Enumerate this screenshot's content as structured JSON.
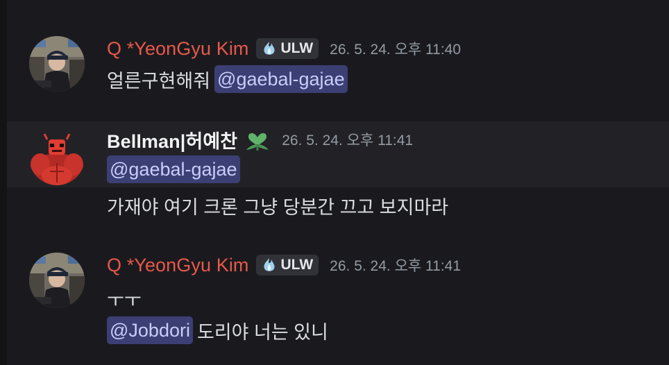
{
  "messages": [
    {
      "author": "Q *YeonGyu Kim",
      "tag": "ULW",
      "timestamp": "26. 5. 24. 오후 11:40",
      "text_before": "얼른구현해줘",
      "mention": "@gaebal-gajae"
    },
    {
      "author": "Bellman|허예찬",
      "timestamp": "26. 5. 24. 오후 11:41",
      "mention": "@gaebal-gajae",
      "text": "가재야 여기 크론 그냥 당분간 끄고 보지마라"
    },
    {
      "author": "Q *YeonGyu Kim",
      "tag": "ULW",
      "timestamp": "26. 5. 24. 오후 11:41",
      "text": "ㅜㅜ",
      "mention": "@Jobdori",
      "text_after": "도리야 너는 있니"
    }
  ],
  "colors": {
    "background": "#1a1a1e",
    "hover_row": "#222226",
    "username_red": "#e8584a",
    "username_white": "#f2f3f5",
    "timestamp": "#949ba4",
    "mention_bg": "#3b3f73",
    "mention_text": "#c9cdfb",
    "tag_bg": "#313238"
  },
  "icons": {
    "tag_icon": "crystal-flame-icon",
    "badge_icon": "green-heart-leaf-icon"
  }
}
